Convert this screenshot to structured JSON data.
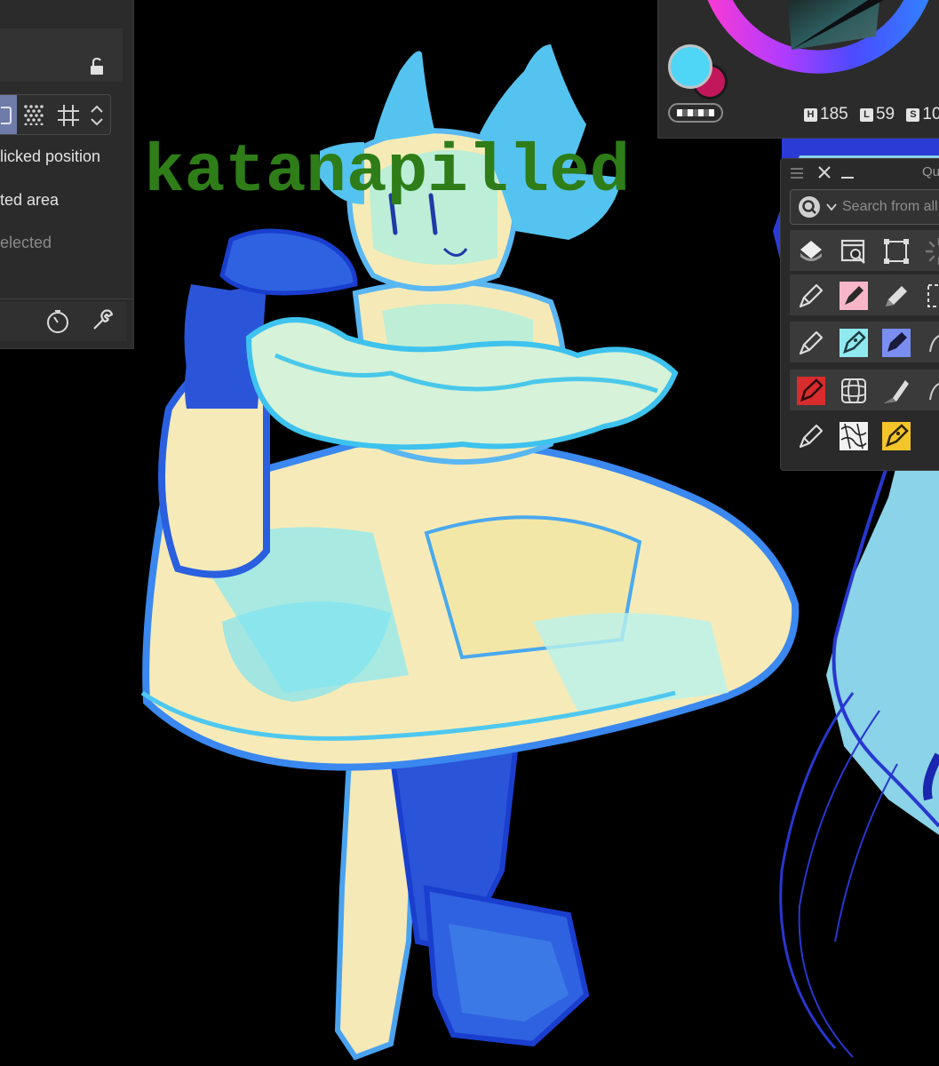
{
  "tool_property": {
    "options": [
      {
        "label": "licked position",
        "enabled": true
      },
      {
        "label": "ted area",
        "enabled": true
      },
      {
        "label": "elected",
        "enabled": false
      }
    ]
  },
  "color_panel": {
    "main_color": "#4fd6f6",
    "sub_color": "#c2185b",
    "hls": [
      {
        "badge": "H",
        "value": "185"
      },
      {
        "badge": "L",
        "value": "59"
      },
      {
        "badge": "S",
        "value": "10"
      }
    ]
  },
  "quick_access": {
    "title": "Qu",
    "search_placeholder": "Search from all fu"
  },
  "canvas": {
    "watermark": "katanapilled",
    "watermark_color": "#2e7d18"
  }
}
